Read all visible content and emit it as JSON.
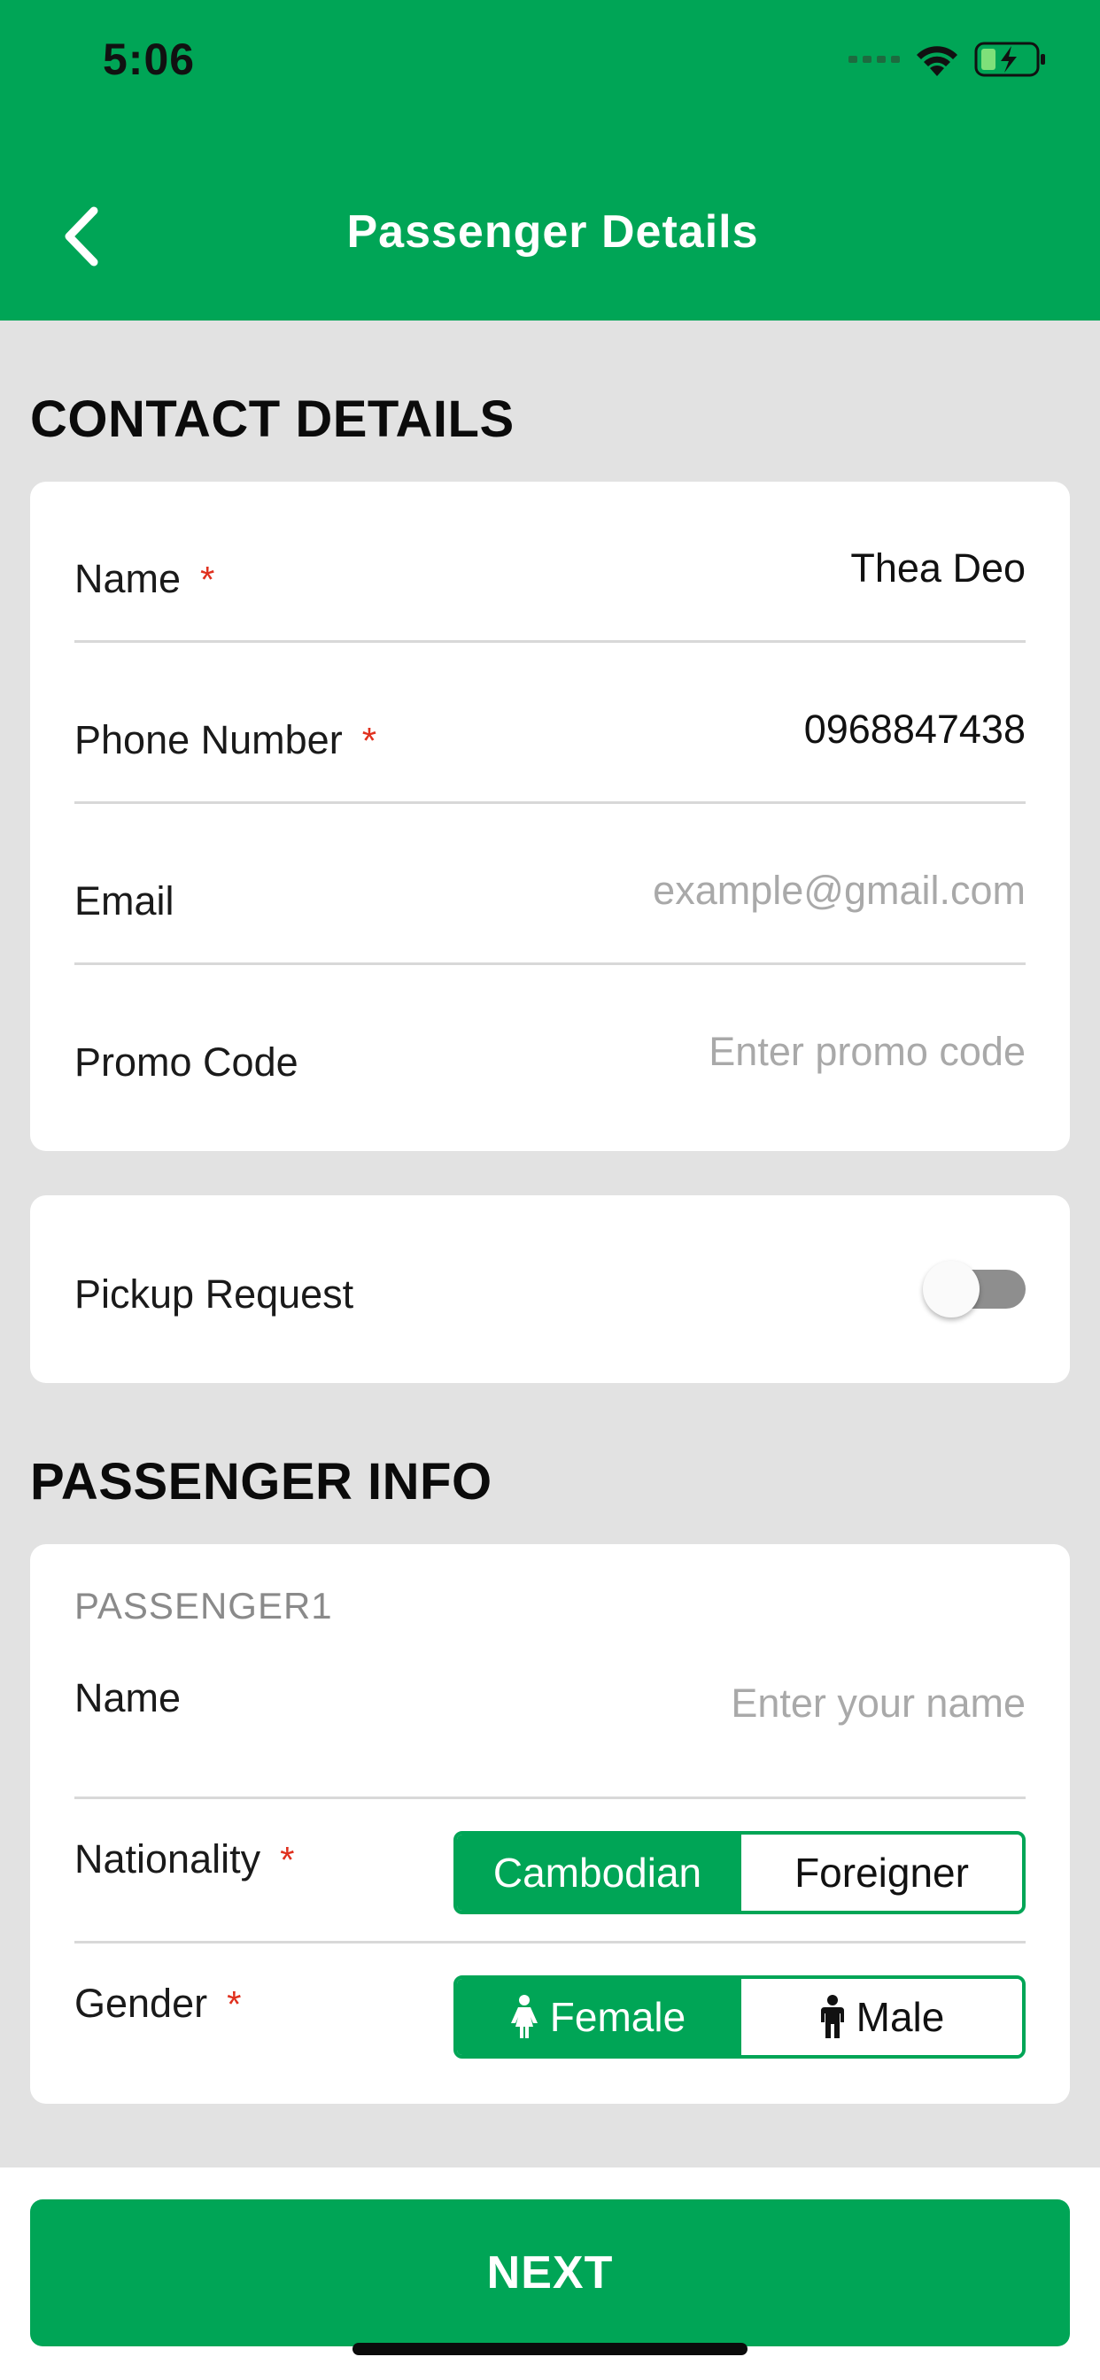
{
  "status_bar": {
    "time": "5:06",
    "icons": [
      "signal-icon",
      "wifi-icon",
      "battery-charging-icon"
    ]
  },
  "header": {
    "title": "Passenger Details",
    "back_icon": "chevron-left-icon",
    "background": "#00a556"
  },
  "contact_details": {
    "section_title": "CONTACT DETAILS",
    "fields": [
      {
        "label": "Name",
        "required": "*",
        "value": "Thea Deo",
        "is_placeholder": false
      },
      {
        "label": "Phone Number",
        "required": "*",
        "value": "0968847438",
        "is_placeholder": false
      },
      {
        "label": "Email",
        "required": "",
        "value": "example@gmail.com",
        "is_placeholder": true
      },
      {
        "label": "Promo Code",
        "required": "",
        "value": "Enter promo code",
        "is_placeholder": true
      }
    ]
  },
  "pickup": {
    "label": "Pickup Request",
    "enabled": false
  },
  "passenger_info": {
    "section_title": "PASSENGER INFO",
    "passenger_label": "PASSENGER1",
    "name": {
      "label": "Name",
      "placeholder": "Enter your name"
    },
    "nationality": {
      "label": "Nationality",
      "required": "*",
      "options": [
        "Cambodian",
        "Foreigner"
      ],
      "selected": "Cambodian"
    },
    "gender": {
      "label": "Gender",
      "required": "*",
      "options": [
        {
          "label": "Female",
          "icon": "female-icon"
        },
        {
          "label": "Male",
          "icon": "male-icon"
        }
      ],
      "selected": "Female"
    }
  },
  "footer": {
    "next_label": "NEXT"
  },
  "colors": {
    "accent": "#00a556",
    "required": "#e0301e",
    "background": "#e2e2e2"
  }
}
